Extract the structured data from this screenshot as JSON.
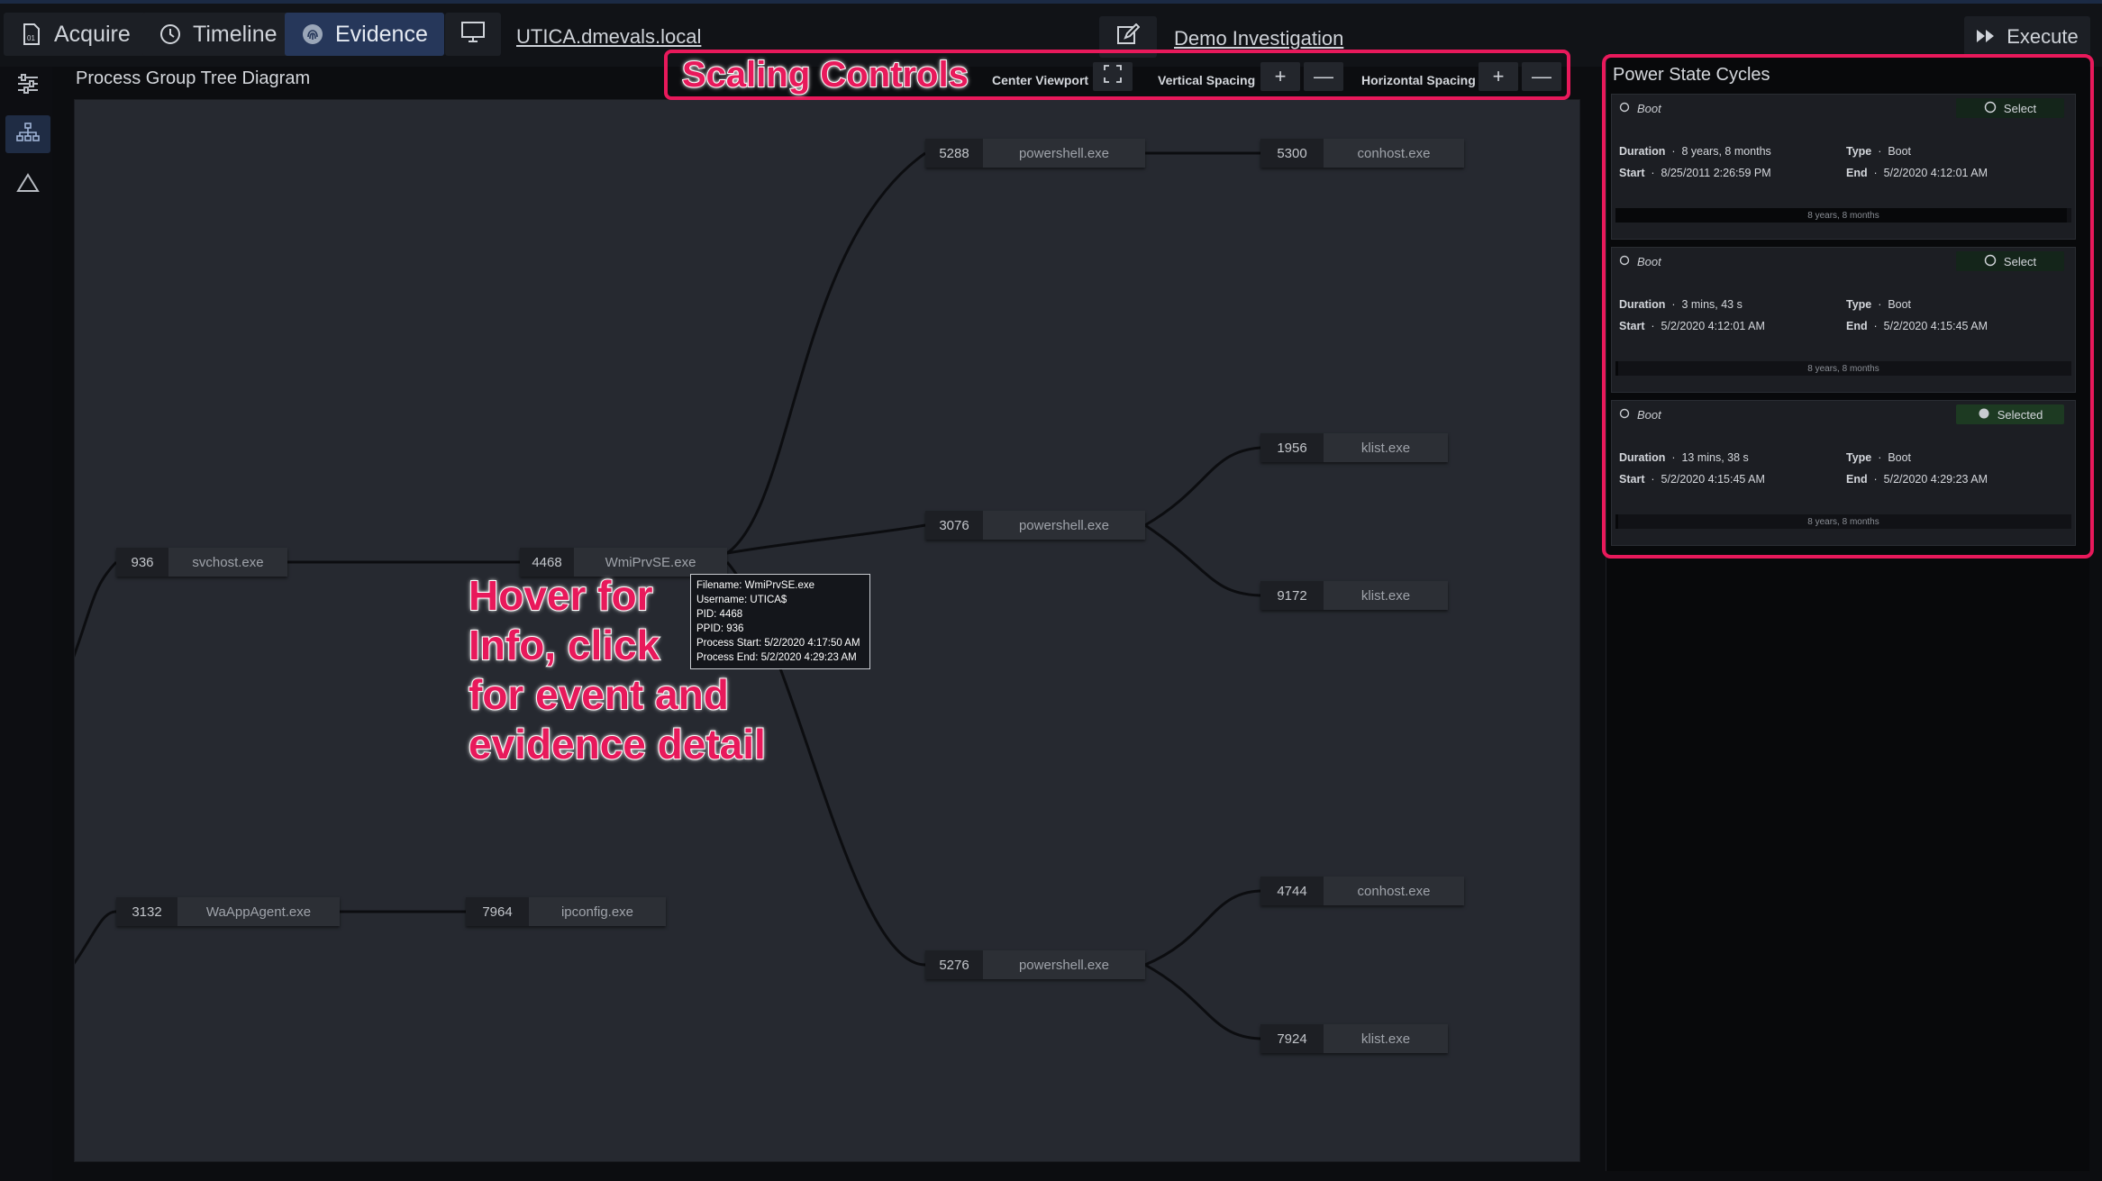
{
  "topbar": {
    "tabs": [
      {
        "label": "Acquire",
        "icon": "acquire-icon"
      },
      {
        "label": "Timeline",
        "icon": "clock-icon"
      },
      {
        "label": "Evidence",
        "icon": "fingerprint-icon"
      }
    ],
    "host": "UTICA.dmevals.local",
    "investigation": "Demo Investigation",
    "execute_label": "Execute"
  },
  "main": {
    "title": "Process Group Tree Diagram",
    "scaling": {
      "annotation": "Scaling Controls",
      "center_label": "Center Viewport",
      "vertical_label": "Vertical Spacing",
      "horizontal_label": "Horizontal Spacing",
      "plus": "+",
      "minus": "—"
    },
    "nodes": [
      {
        "pid": "936",
        "name": "svchost.exe"
      },
      {
        "pid": "4468",
        "name": "WmiPrvSE.exe"
      },
      {
        "pid": "5288",
        "name": "powershell.exe"
      },
      {
        "pid": "5300",
        "name": "conhost.exe"
      },
      {
        "pid": "3076",
        "name": "powershell.exe"
      },
      {
        "pid": "1956",
        "name": "klist.exe"
      },
      {
        "pid": "9172",
        "name": "klist.exe"
      },
      {
        "pid": "5276",
        "name": "powershell.exe"
      },
      {
        "pid": "4744",
        "name": "conhost.exe"
      },
      {
        "pid": "7924",
        "name": "klist.exe"
      },
      {
        "pid": "3132",
        "name": "WaAppAgent.exe"
      },
      {
        "pid": "7964",
        "name": "ipconfig.exe"
      }
    ],
    "tooltip": [
      "Filename: WmiPrvSE.exe",
      "Username: UTICA$",
      "PID: 4468",
      "PPID: 936",
      "Process Start: 5/2/2020 4:17:50 AM",
      "Process End: 5/2/2020 4:29:23 AM"
    ],
    "hover_annotation": [
      "Hover for",
      "Info, click",
      "for event and",
      "evidence detail"
    ]
  },
  "power": {
    "title": "Power State Cycles",
    "cycles": [
      {
        "title": "Boot",
        "select_label": "Select",
        "selected": false,
        "duration_label": "Duration",
        "duration": "8 years, 8 months",
        "type_label": "Type",
        "type": "Boot",
        "start_label": "Start",
        "start": "8/25/2011 2:26:59 PM",
        "end_label": "End",
        "end": "5/2/2020 4:12:01 AM",
        "bar_label": "8 years, 8 months",
        "bar_fraction": 0.99
      },
      {
        "title": "Boot",
        "select_label": "Select",
        "selected": false,
        "duration_label": "Duration",
        "duration": "3 mins, 43 s",
        "type_label": "Type",
        "type": "Boot",
        "start_label": "Start",
        "start": "5/2/2020 4:12:01 AM",
        "end_label": "End",
        "end": "5/2/2020 4:15:45 AM",
        "bar_label": "8 years, 8 months",
        "bar_fraction": 0.005
      },
      {
        "title": "Boot",
        "select_label": "Selected",
        "selected": true,
        "duration_label": "Duration",
        "duration": "13 mins, 38 s",
        "type_label": "Type",
        "type": "Boot",
        "start_label": "Start",
        "start": "5/2/2020 4:15:45 AM",
        "end_label": "End",
        "end": "5/2/2020 4:29:23 AM",
        "bar_label": "8 years, 8 months",
        "bar_fraction": 0.005
      }
    ]
  },
  "colors": {
    "accent": "#e8195b",
    "active_tab": "#26375a",
    "canvas": "#262930"
  }
}
